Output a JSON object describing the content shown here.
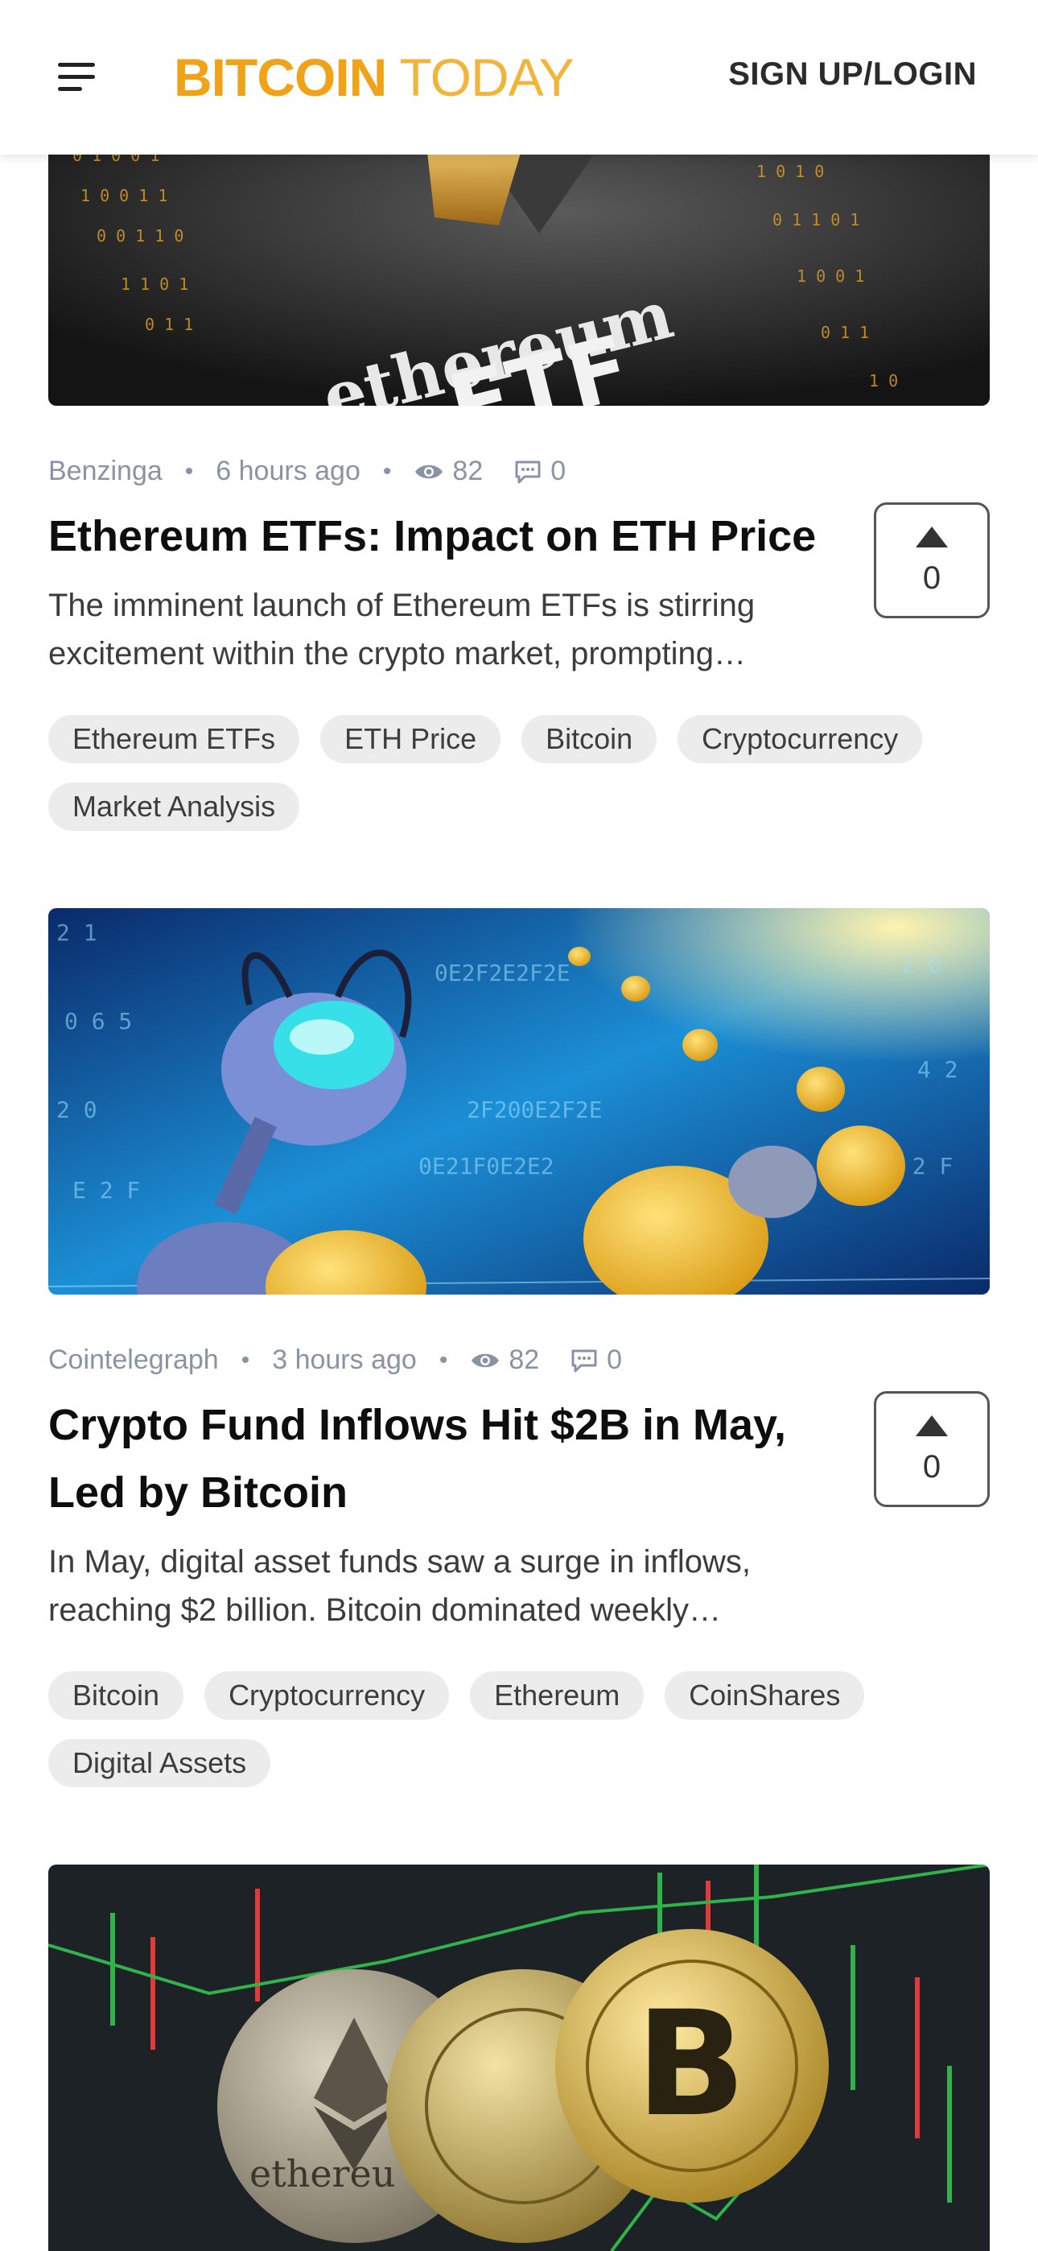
{
  "header": {
    "logo_part1": "BITCOIN",
    "logo_part2": "TODAY",
    "signup_label": "SIGN UP/LOGIN"
  },
  "colors": {
    "brand": "#f0a318",
    "meta": "#8894a5",
    "tag_bg": "#ececec"
  },
  "articles": [
    {
      "image_text": "ethereum ETF",
      "source": "Benzinga",
      "time": "6 hours ago",
      "views": "82",
      "comments": "0",
      "title": "Ethereum ETFs: Impact on ETH Price",
      "excerpt": "The imminent launch of Ethereum ETFs is stirring excitement within the crypto market, prompting…",
      "votes": "0",
      "tags": [
        "Ethereum ETFs",
        "ETH Price",
        "Bitcoin",
        "Cryptocurrency",
        "Market Analysis"
      ]
    },
    {
      "source": "Cointelegraph",
      "time": "3 hours ago",
      "views": "82",
      "comments": "0",
      "title": "Crypto Fund Inflows Hit $2B in May, Led by Bitcoin",
      "excerpt": "In May, digital asset funds saw a surge in inflows, reaching $2 billion. Bitcoin dominated weekly…",
      "votes": "0",
      "tags": [
        "Bitcoin",
        "Cryptocurrency",
        "Ethereum",
        "CoinShares",
        "Digital Assets"
      ]
    },
    {
      "image_text": "ethereu"
    }
  ]
}
